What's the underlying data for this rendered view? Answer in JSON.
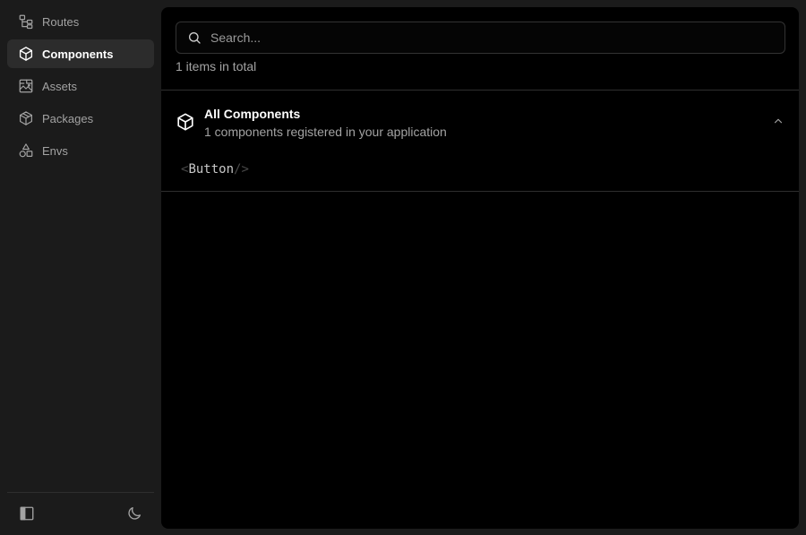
{
  "sidebar": {
    "items": [
      {
        "label": "Routes",
        "icon": "routes-tree-icon",
        "active": false
      },
      {
        "label": "Components",
        "icon": "cube-icon",
        "active": true
      },
      {
        "label": "Assets",
        "icon": "image-assets-icon",
        "active": false
      },
      {
        "label": "Packages",
        "icon": "package-icon",
        "active": false
      },
      {
        "label": "Envs",
        "icon": "shapes-icon",
        "active": false
      }
    ],
    "footer": {
      "toggle_icon": "sidebar-toggle-icon",
      "theme_icon": "moon-icon"
    }
  },
  "main": {
    "search": {
      "placeholder": "Search...",
      "value": ""
    },
    "total_text": "1 items in total",
    "section": {
      "title": "All Components",
      "subtitle": "1 components registered in your application",
      "icon": "cube-icon",
      "toggle_icon": "chevron-up-icon",
      "components": [
        {
          "open": "<",
          "name": "Button",
          "close": "/>"
        }
      ]
    }
  },
  "colors": {
    "sidebar_bg": "#1b1b1b",
    "main_bg": "#000000",
    "active_item_bg": "#2c2c2c",
    "muted_text": "#a3a3a3"
  }
}
